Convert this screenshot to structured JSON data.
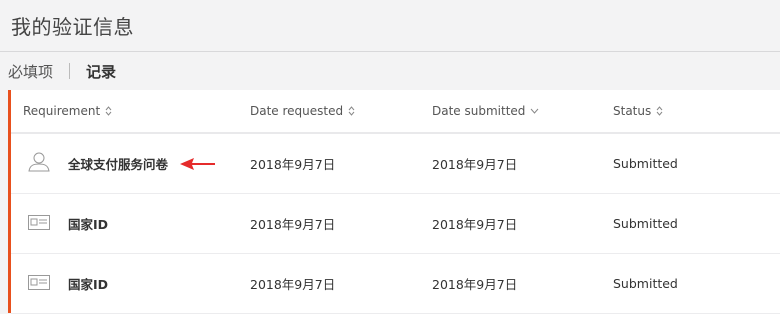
{
  "page": {
    "title": "我的验证信息"
  },
  "tabs": [
    {
      "label": "必填项",
      "active": false
    },
    {
      "label": "记录",
      "active": true
    }
  ],
  "table": {
    "columns": [
      {
        "label": "Requirement",
        "sort_icon": "sort-both-icon"
      },
      {
        "label": "Date requested",
        "sort_icon": "sort-both-icon"
      },
      {
        "label": "Date submitted",
        "sort_icon": "sort-desc-icon"
      },
      {
        "label": "Status",
        "sort_icon": "sort-both-icon"
      }
    ],
    "rows": [
      {
        "icon": "person-icon",
        "requirement": "全球支付服务问卷",
        "date_requested": "2018年9月7日",
        "date_submitted": "2018年9月7日",
        "status": "Submitted",
        "annotated": true
      },
      {
        "icon": "id-card-icon",
        "requirement": "国家ID",
        "date_requested": "2018年9月7日",
        "date_submitted": "2018年9月7日",
        "status": "Submitted",
        "annotated": false
      },
      {
        "icon": "id-card-icon",
        "requirement": "国家ID",
        "date_requested": "2018年9月7日",
        "date_submitted": "2018年9月7日",
        "status": "Submitted",
        "annotated": false
      }
    ]
  },
  "colors": {
    "accent": "#e8501d",
    "annotation_arrow": "#e52b2b"
  }
}
